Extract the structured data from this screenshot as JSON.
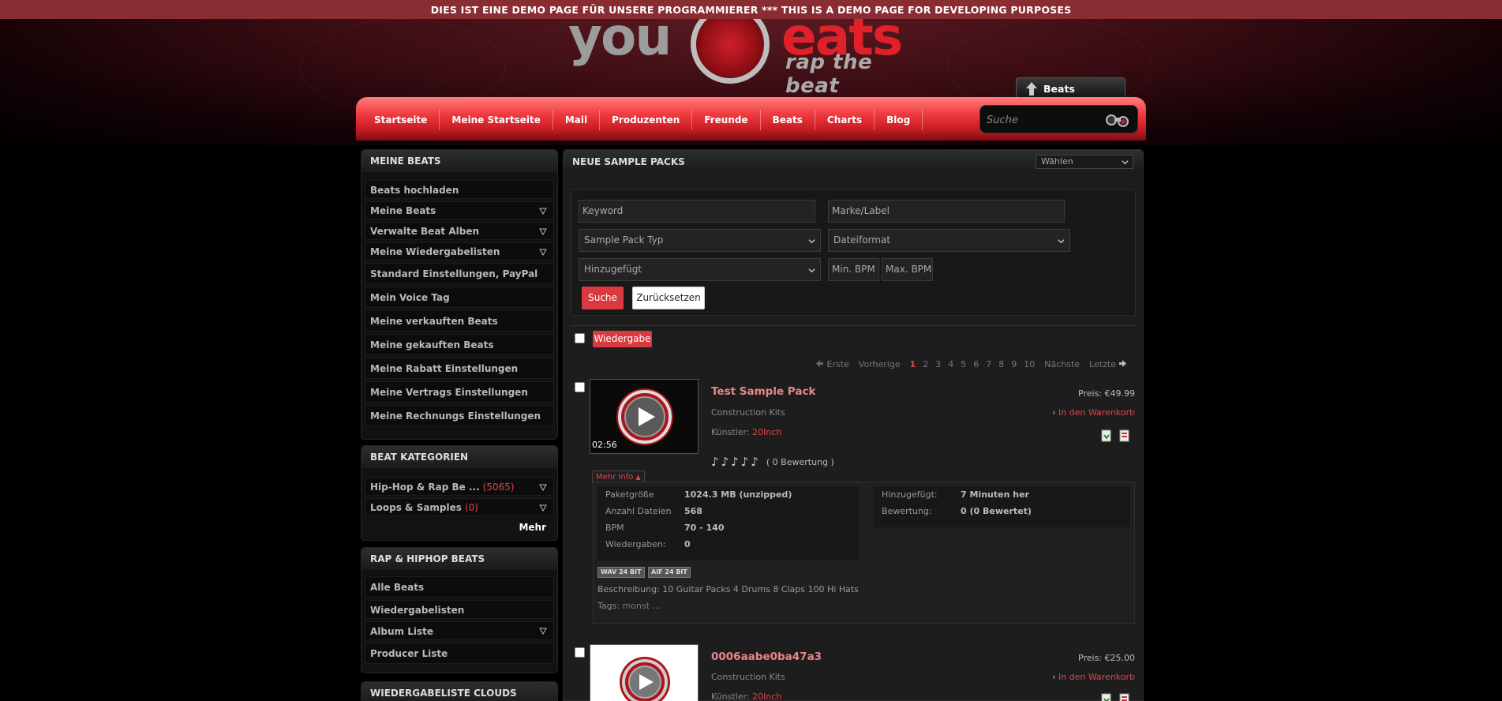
{
  "demo_banner": "DIES IST EINE DEMO PAGE FÜR UNSERE PROGRAMMIERER *** THIS IS A DEMO PAGE FOR DEVELOPING PURPOSES",
  "logo": {
    "you": "you",
    "beats": "eats",
    "tagline": "rap the beat"
  },
  "upload_button": "Beats hochladen",
  "nav": [
    "Startseite",
    "Meine Startseite",
    "Mail",
    "Produzenten",
    "Freunde",
    "Beats",
    "Charts",
    "Blog"
  ],
  "search": {
    "placeholder": "Suche"
  },
  "sidebar": {
    "my_beats": {
      "title": "MEINE BEATS",
      "items": [
        {
          "label": "Beats hochladen",
          "chev": false
        },
        {
          "label": "Meine Beats",
          "chev": true
        },
        {
          "label": "Verwalte Beat Alben",
          "chev": true
        },
        {
          "label": "Meine Wiedergabelisten",
          "chev": true
        },
        {
          "label": "Standard Einstellungen, PayPal & Bank",
          "chev": false
        },
        {
          "label": "Mein Voice Tag",
          "chev": false
        },
        {
          "label": "Meine verkauften Beats",
          "chev": false
        },
        {
          "label": "Meine gekauften Beats",
          "chev": false
        },
        {
          "label": "Meine Rabatt Einstellungen",
          "chev": false
        },
        {
          "label": "Meine Vertrags Einstellungen",
          "chev": false
        },
        {
          "label": "Meine Rechnungs Einstellungen",
          "chev": false
        }
      ]
    },
    "categories": {
      "title": "BEAT KATEGORIEN",
      "items": [
        {
          "label": "Hip-Hop & Rap Be ...",
          "count": "(5065)"
        },
        {
          "label": "Loops & Samples",
          "count": "(0)"
        }
      ],
      "more": "Mehr"
    },
    "rap_beats": {
      "title": "RAP & HIPHOP BEATS",
      "items": [
        {
          "label": "Alle Beats",
          "chev": false
        },
        {
          "label": "Wiedergabelisten",
          "chev": false
        },
        {
          "label": "Album Liste",
          "chev": true
        },
        {
          "label": "Producer Liste",
          "chev": false
        }
      ]
    },
    "clouds": {
      "title": "WIEDERGABELISTE CLOUDS"
    }
  },
  "main": {
    "title": "NEUE SAMPLE PACKS",
    "sort_value": "Wählen",
    "filters": {
      "keyword": "Keyword",
      "label": "Marke/Label",
      "pack_type": "Sample Pack Typ",
      "file_format": "Dateiformat",
      "added": "Hinzugefügt",
      "min_bpm": "Min. BPM",
      "max_bpm": "Max. BPM",
      "search_btn": "Suche",
      "reset_btn": "Zurücksetzen"
    },
    "play_button": "Wiedergabe",
    "pagination": {
      "first": "Erste",
      "prev": "Vorherige",
      "pages": [
        "1",
        "2",
        "3",
        "4",
        "5",
        "6",
        "7",
        "8",
        "9",
        "10"
      ],
      "current": "1",
      "next": "Nächste",
      "last": "Letzte"
    },
    "items": [
      {
        "title": "Test Sample Pack",
        "duration": "02:56",
        "type": "Construction Kits",
        "artist_label": "Künstler:",
        "artist": "20Inch",
        "price": "Preis: €49.99",
        "cart": "In den Warenkorb",
        "rating_text": "( 0 Bewertung )",
        "more_info": "Mehr Info",
        "details_left": [
          {
            "k": "Paketgröße",
            "v": "1024.3 MB (unzipped)"
          },
          {
            "k": "Anzahl Dateien",
            "v": "568"
          },
          {
            "k": "BPM",
            "v": "70 - 140"
          },
          {
            "k": "Wiedergaben:",
            "v": "0"
          }
        ],
        "details_right": [
          {
            "k": "Hinzugefügt:",
            "v": "7 Minuten her"
          },
          {
            "k": "Bewertung:",
            "v": "0 (0 Bewertet)"
          }
        ],
        "formats": [
          "WAV 24 BIT",
          "AIF 24 BIT"
        ],
        "description": "Beschreibung: 10 Guitar Packs 4 Drums 8 Claps 100 Hi Hats",
        "tags_label": "Tags:",
        "tags": "monst ..."
      },
      {
        "title": "0006aabe0ba47a3",
        "type": "Construction Kits",
        "artist_label": "Künstler:",
        "artist": "20Inch",
        "price": "Preis: €25.00",
        "cart": "In den Warenkorb"
      }
    ]
  },
  "colors": {
    "accent": "#d93a40",
    "banner": "#8a2d33",
    "link": "#e9868a"
  }
}
